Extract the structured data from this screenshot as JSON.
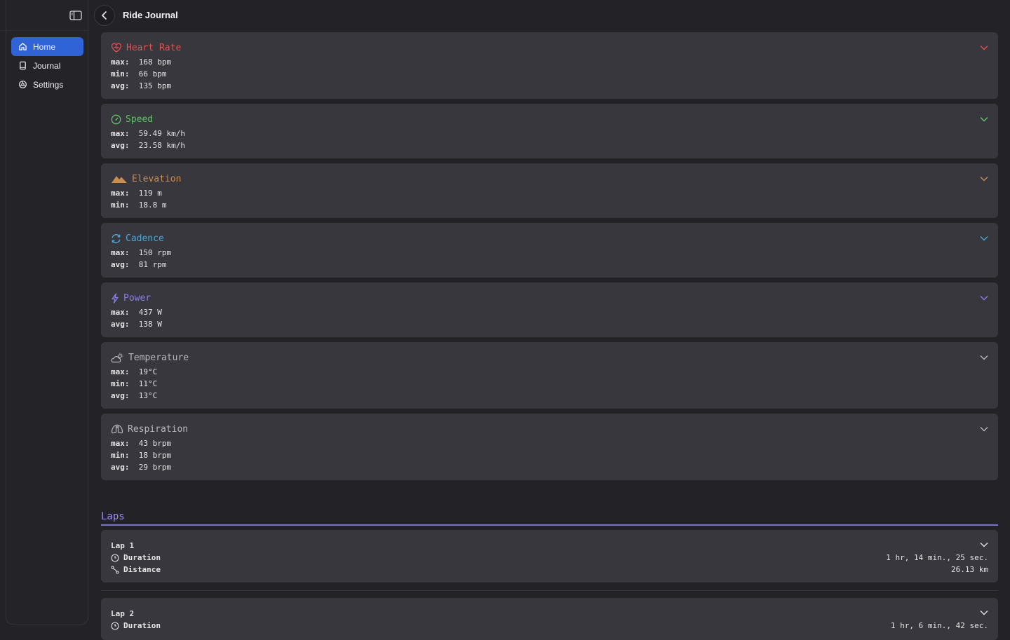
{
  "header": {
    "title": "Ride Journal"
  },
  "sidebar": {
    "items": [
      {
        "label": "Home",
        "icon": "home-icon",
        "active": true
      },
      {
        "label": "Journal",
        "icon": "book-icon",
        "active": false
      },
      {
        "label": "Settings",
        "icon": "gear-icon",
        "active": false
      }
    ]
  },
  "colors": {
    "heart_rate": "#e0524f",
    "speed": "#5fc36a",
    "elevation": "#c98c55",
    "cadence": "#4aa7d6",
    "power": "#8a7ee8",
    "temperature": "#b8b8bc",
    "respiration": "#b8b8bc",
    "accent": "#2f63d6",
    "laps": "#9d8ff0"
  },
  "metrics": {
    "heart_rate": {
      "title": "Heart Rate",
      "icon": "heart-pulse-icon",
      "rows": [
        {
          "label": "max:",
          "value": "168 bpm"
        },
        {
          "label": "min:",
          "value": "66 bpm"
        },
        {
          "label": "avg:",
          "value": "135 bpm"
        }
      ]
    },
    "speed": {
      "title": "Speed",
      "icon": "speedometer-icon",
      "rows": [
        {
          "label": "max:",
          "value": "59.49 km/h"
        },
        {
          "label": "avg:",
          "value": "23.58 km/h"
        }
      ]
    },
    "elevation": {
      "title": "Elevation",
      "icon": "mountain-icon",
      "rows": [
        {
          "label": "max:",
          "value": "119 m"
        },
        {
          "label": "min:",
          "value": "18.8 m"
        }
      ]
    },
    "cadence": {
      "title": "Cadence",
      "icon": "cycle-arrows-icon",
      "rows": [
        {
          "label": "max:",
          "value": "150 rpm"
        },
        {
          "label": "avg:",
          "value": "81 rpm"
        }
      ]
    },
    "power": {
      "title": "Power",
      "icon": "lightning-icon",
      "rows": [
        {
          "label": "max:",
          "value": "437 W"
        },
        {
          "label": "avg:",
          "value": "138 W"
        }
      ]
    },
    "temperature": {
      "title": "Temperature",
      "icon": "cloud-sun-icon",
      "rows": [
        {
          "label": "max:",
          "value": "19°C"
        },
        {
          "label": "min:",
          "value": "11°C"
        },
        {
          "label": "avg:",
          "value": "13°C"
        }
      ]
    },
    "respiration": {
      "title": "Respiration",
      "icon": "lungs-icon",
      "rows": [
        {
          "label": "max:",
          "value": "43 brpm"
        },
        {
          "label": "min:",
          "value": "18 brpm"
        },
        {
          "label": "avg:",
          "value": "29 brpm"
        }
      ]
    }
  },
  "laps": {
    "heading": "Laps",
    "items": [
      {
        "title": "Lap 1",
        "duration_label": "Duration",
        "duration": "1 hr, 14 min., 25 sec.",
        "distance_label": "Distance",
        "distance": "26.13 km"
      },
      {
        "title": "Lap 2",
        "duration_label": "Duration",
        "duration": "1 hr, 6 min., 42 sec."
      }
    ]
  }
}
